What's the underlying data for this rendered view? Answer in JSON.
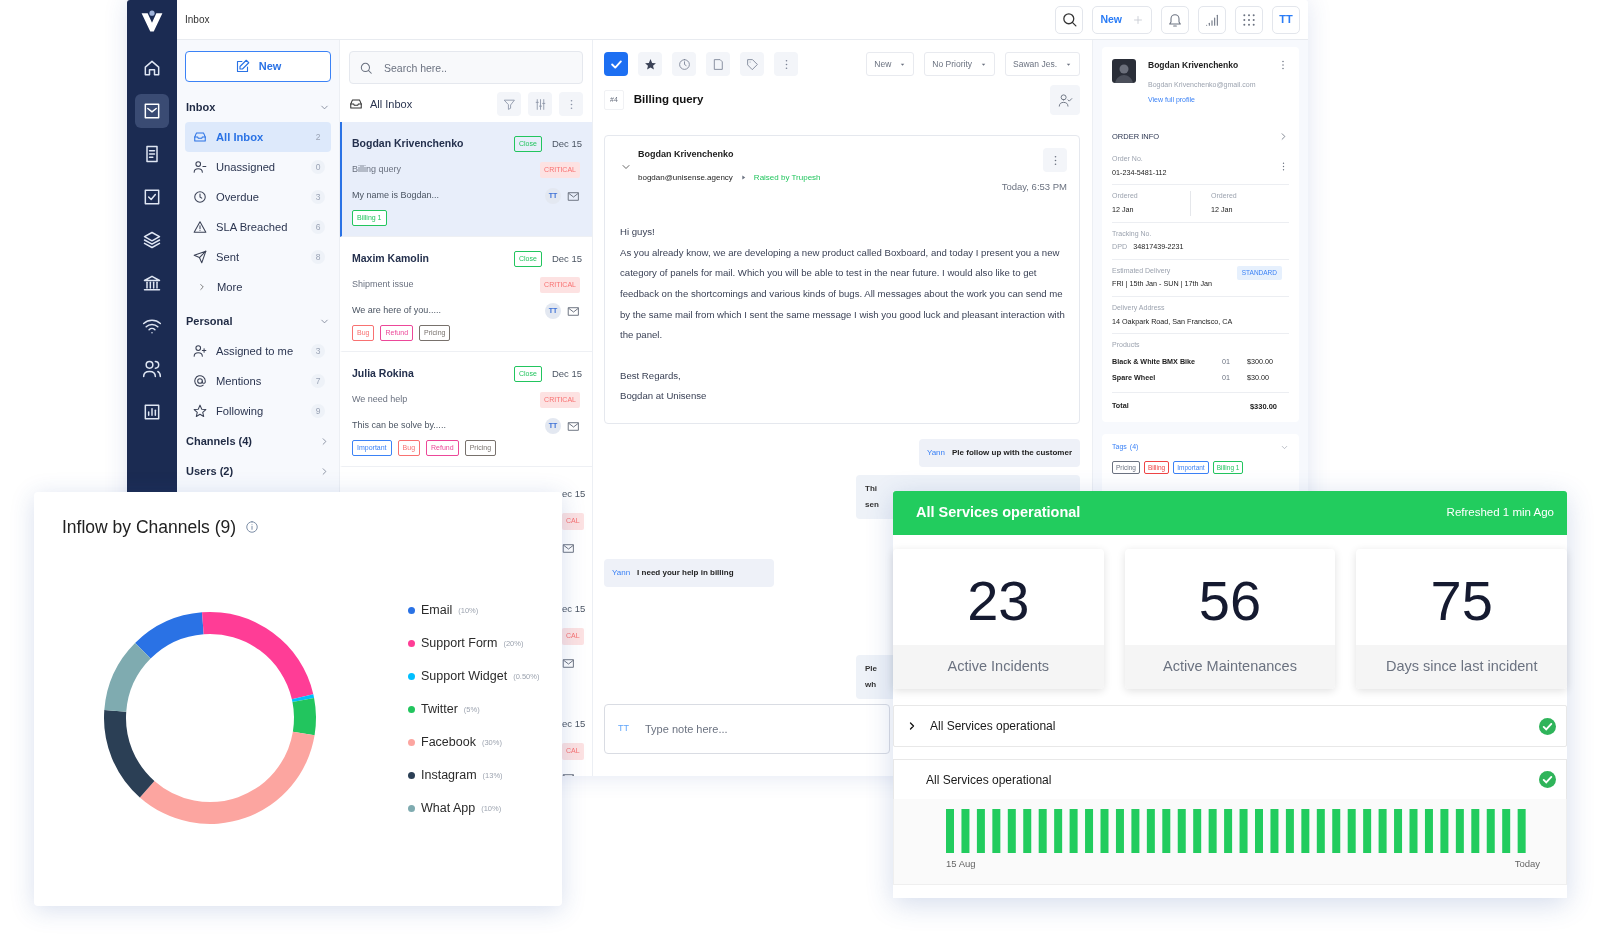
{
  "app": {
    "rail": [
      {
        "selected": false
      },
      {
        "selected": true
      },
      {
        "selected": false
      },
      {
        "selected": false
      },
      {
        "selected": false
      },
      {
        "selected": false
      },
      {
        "selected": false
      },
      {
        "selected": false
      },
      {
        "selected": false
      }
    ],
    "topbar": {
      "title": "Inbox",
      "new_button": "New",
      "user": "TT"
    },
    "nav": {
      "new_button": "New",
      "sections": [
        {
          "title": "Inbox",
          "expanded": true,
          "items": [
            {
              "label": "All Inbox",
              "count": "2",
              "selected": true
            },
            {
              "label": "Unassigned",
              "count": "0",
              "selected": false
            },
            {
              "label": "Overdue",
              "count": "3",
              "selected": false
            },
            {
              "label": "SLA Breached",
              "count": "6",
              "selected": false
            },
            {
              "label": "Sent",
              "count": "8",
              "selected": false
            }
          ],
          "more": "More"
        },
        {
          "title": "Personal",
          "expanded": true,
          "items": [
            {
              "label": "Assigned to me",
              "count": "3",
              "selected": false
            },
            {
              "label": "Mentions",
              "count": "7",
              "selected": false
            },
            {
              "label": "Following",
              "count": "9",
              "selected": false
            }
          ]
        },
        {
          "title": "Channels (4)",
          "expanded": false
        },
        {
          "title": "Users (2)",
          "expanded": false
        }
      ]
    },
    "list": {
      "search_placeholder": "Search here..",
      "title": "All Inbox",
      "items": [
        {
          "name": "Bogdan Krivenchenko",
          "status": "Close",
          "date": "Dec 15",
          "subject": "Billing query",
          "priority": "CRITICAL",
          "preview": "My name is Bogdan...",
          "user": "TT",
          "tags": [
            {
              "label": "Billing 1",
              "color": "#22c55e"
            }
          ],
          "selected": true
        },
        {
          "name": "Maxim Kamolin",
          "status": "Close",
          "date": "Dec 15",
          "subject": "Shipment issue",
          "priority": "CRITICAL",
          "preview": "We are here of you.....",
          "user": "TT",
          "tags": [
            {
              "label": "Bug",
              "color": "#f87171"
            },
            {
              "label": "Refund",
              "color": "#ec4899"
            },
            {
              "label": "Pricing",
              "color": "#78716c"
            }
          ],
          "selected": false
        },
        {
          "name": "Julia Rokina",
          "status": "Close",
          "date": "Dec 15",
          "subject": "We need help",
          "priority": "CRITICAL",
          "preview": "This can be solve by.....",
          "user": "TT",
          "tags": [
            {
              "label": "Important",
              "color": "#3b82f6"
            },
            {
              "label": "Bug",
              "color": "#f87171"
            },
            {
              "label": "Refund",
              "color": "#ec4899"
            },
            {
              "label": "Pricing",
              "color": "#78716c"
            }
          ],
          "selected": false
        },
        {
          "date": "ec 15",
          "priority": "CAL",
          "selected": false
        },
        {
          "date": "ec 15",
          "priority": "CAL",
          "selected": false
        },
        {
          "date": "ec 15",
          "priority": "CAL",
          "selected": false
        }
      ]
    },
    "ticket": {
      "select_checked": true,
      "status": "New",
      "priority": "No Priority",
      "assignee": "Sawan Jes.",
      "number": "#4",
      "subject": "Billing query",
      "message": {
        "sender": "Bogdan Krivenchenko",
        "email": "bogdan@unisense.agency",
        "raised_by": "Raised by Trupesh",
        "time": "Today, 6:53 PM",
        "body": [
          "Hi guys!",
          "As you already know, we are developing a new product called Boxboard, and today I present you a new category of panels for mail. Which you will be able to test in the near future. I would also like to get feedback on the shortcomings and various kinds of bugs. All messages about the work you can send me by the same mail from which I sent the same message I wish you good luck and pleasant interaction with the panel."
        ],
        "signature": [
          "Best Regards,",
          "Bogdan at Unisense"
        ]
      },
      "notes": [
        {
          "kind": "right-note",
          "author": "Yann",
          "text": "Ple follow up with the customer"
        },
        {
          "kind": "cut-note",
          "lines": [
            "Thi",
            "sen"
          ]
        },
        {
          "kind": "left-note",
          "author": "Yann",
          "text": "I need your help in billing"
        },
        {
          "kind": "cut-note",
          "lines": [
            "Ple",
            "wh"
          ]
        }
      ],
      "composer": {
        "user": "TT",
        "placeholder": "Type note here..."
      }
    },
    "customer": {
      "name": "Bogdan Krivenchenko",
      "email": "Bogdan Krivenchenko@gmail.com",
      "profile_link": "View full profile",
      "order_title": "ORDER INFO",
      "order_no_label": "Order No.",
      "order_no": "01-234-5481-112",
      "ordered": [
        {
          "label": "Ordered",
          "value": "12 Jan"
        },
        {
          "label": "Ordered",
          "value": "12 Jan"
        }
      ],
      "tracking_label": "Tracking No.",
      "carrier": "DPD",
      "tracking_no": "34817439-2231",
      "delivery_label": "Estimated Delivery",
      "delivery": "FRI | 15th Jan - SUN | 17th Jan",
      "delivery_badge": "STANDARD",
      "address_label": "Delivery Address",
      "address": "14 Oakpark Road, San Francisco, CA",
      "products_label": "Products",
      "products": [
        {
          "name": "Black & White BMX Bike",
          "qty": "01",
          "price": "$300.00"
        },
        {
          "name": "Spare Wheel",
          "qty": "01",
          "price": "$30.00"
        }
      ],
      "total_label": "Total",
      "total": "$330.00",
      "tags_title": "Tags",
      "tags_count": "(4)",
      "tags": [
        {
          "label": "Pricing",
          "color": "#6b7280"
        },
        {
          "label": "Billing",
          "color": "#ef4444"
        },
        {
          "label": "Important",
          "color": "#3b82f6"
        },
        {
          "label": "Billing 1",
          "color": "#22c55e"
        }
      ]
    }
  },
  "inflow": {
    "chart_data": {
      "type": "donut",
      "title": "Inflow by Channels (9)",
      "categories": [
        "Email",
        "Support Form",
        "Support Widget",
        "Twitter",
        "Facebook",
        "Instagram",
        "What App"
      ],
      "values": [
        11.3,
        22.6,
        0.56,
        5.65,
        33.9,
        14.69,
        11.3
      ]
    },
    "legend": [
      {
        "share": "(10%)",
        "color": "#2a72e5"
      },
      {
        "share": "(20%)",
        "color": "#ff3d96"
      },
      {
        "share": "(0.50%)",
        "color": "#00bfff"
      },
      {
        "share": "(5%)",
        "color": "#22c55e"
      },
      {
        "share": "(30%)",
        "color": "#fca5a0"
      },
      {
        "share": "(13%)",
        "color": "#2b3f55"
      },
      {
        "share": "(10%)",
        "color": "#7fabb0"
      }
    ]
  },
  "status": {
    "title": "All Services operational",
    "refreshed": "Refreshed 1 min Ago",
    "stats": [
      {
        "value": "23",
        "label": "Active Incidents"
      },
      {
        "value": "56",
        "label": "Active Maintenances"
      },
      {
        "value": "75",
        "label": "Days since last incident"
      }
    ],
    "rows": [
      {
        "label": "All Services operational",
        "expandable": true,
        "ok": true
      },
      {
        "label": "All Services operational",
        "expandable": false,
        "ok": true
      }
    ],
    "timeline": {
      "start": "15 Aug",
      "end": "Today"
    }
  }
}
